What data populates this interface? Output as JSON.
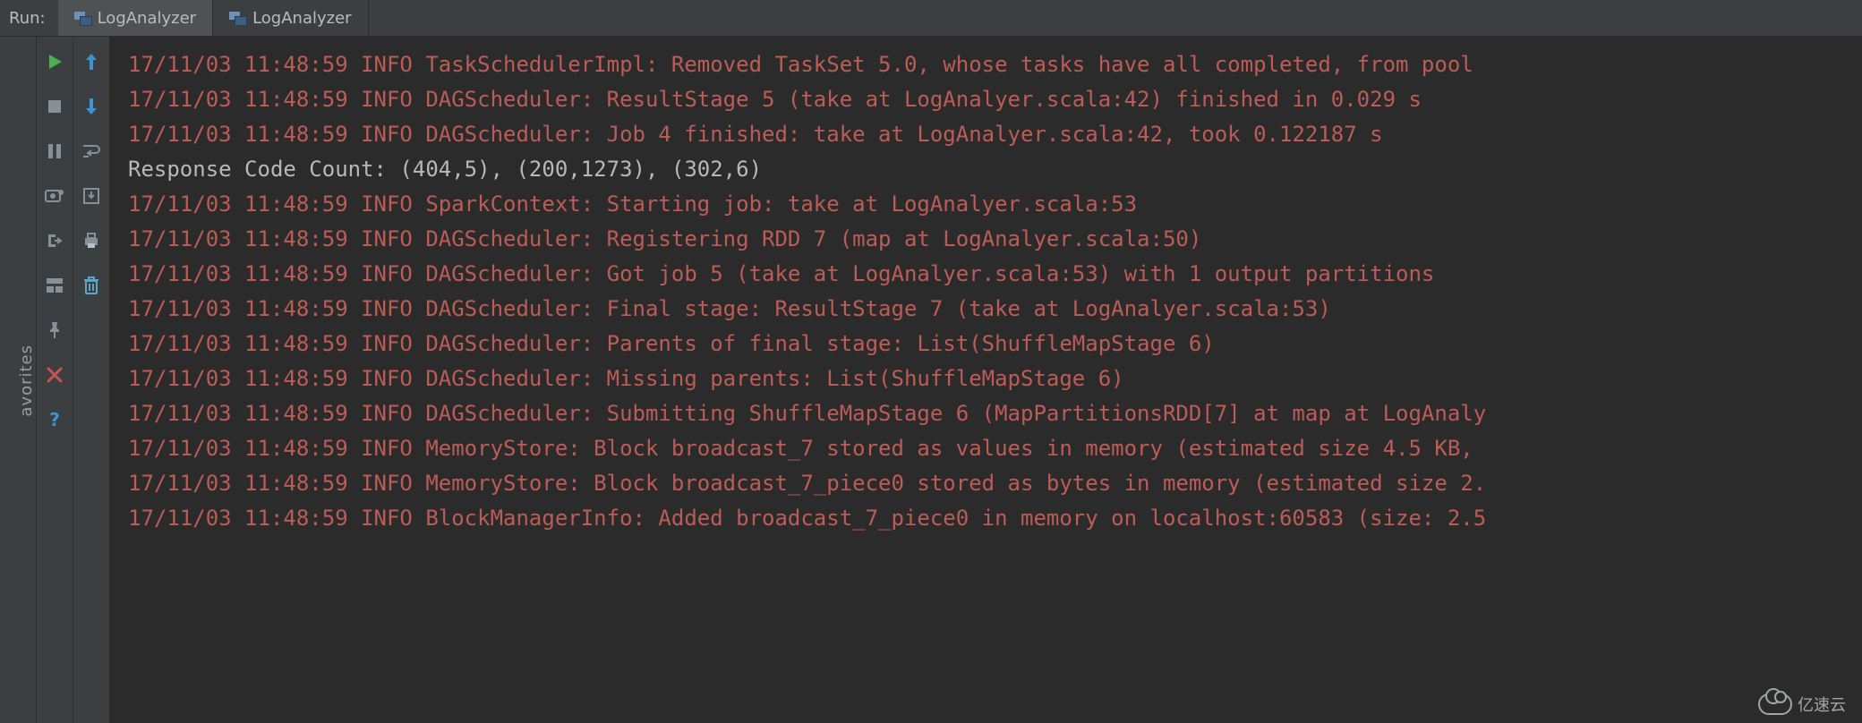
{
  "header": {
    "run_label": "Run:",
    "tabs": [
      {
        "label": "LogAnalyzer",
        "active": true
      },
      {
        "label": "LogAnalyzer",
        "active": false
      }
    ]
  },
  "left_rail": {
    "label": "avorites"
  },
  "toolbar_col1": [
    {
      "name": "rerun-icon",
      "title": "Rerun",
      "color": "#4caf50"
    },
    {
      "name": "stop-icon",
      "title": "Stop",
      "color": "#8a8f94"
    },
    {
      "name": "pause-icon",
      "title": "Pause",
      "color": "#8a8f94"
    },
    {
      "name": "dump-icon",
      "title": "Dump Threads",
      "color": "#8a8f94"
    },
    {
      "name": "exit-icon",
      "title": "Exit",
      "color": "#8a8f94"
    },
    {
      "name": "layout-icon",
      "title": "Restore Layout",
      "color": "#8a8f94"
    },
    {
      "name": "pin-icon",
      "title": "Pin Tab",
      "color": "#8a8f94"
    },
    {
      "name": "close-icon",
      "title": "Close",
      "color": "#c75450"
    },
    {
      "name": "help-icon",
      "title": "Help",
      "color": "#3d94d1"
    }
  ],
  "toolbar_col2": [
    {
      "name": "scroll-up-icon",
      "title": "Up Trace",
      "color": "#3d94d1"
    },
    {
      "name": "scroll-down-icon",
      "title": "Down Trace",
      "color": "#3d94d1"
    },
    {
      "name": "soft-wrap-icon",
      "title": "Soft-Wrap",
      "color": "#8a8f94"
    },
    {
      "name": "scroll-end-icon",
      "title": "Scroll to End",
      "color": "#8a8f94"
    },
    {
      "name": "print-icon",
      "title": "Print",
      "color": "#8a8f94"
    },
    {
      "name": "clear-icon",
      "title": "Clear All",
      "color": "#5aa7c7"
    }
  ],
  "console": {
    "lines": [
      {
        "kind": "log",
        "text": "17/11/03 11:48:59 INFO TaskSchedulerImpl: Removed TaskSet 5.0, whose tasks have all completed, from pool "
      },
      {
        "kind": "log",
        "text": "17/11/03 11:48:59 INFO DAGScheduler: ResultStage 5 (take at LogAnalyer.scala:42) finished in 0.029 s"
      },
      {
        "kind": "log",
        "text": "17/11/03 11:48:59 INFO DAGScheduler: Job 4 finished: take at LogAnalyer.scala:42, took 0.122187 s"
      },
      {
        "kind": "stdout",
        "text": "Response Code Count: (404,5), (200,1273), (302,6)"
      },
      {
        "kind": "log",
        "text": "17/11/03 11:48:59 INFO SparkContext: Starting job: take at LogAnalyer.scala:53"
      },
      {
        "kind": "log",
        "text": "17/11/03 11:48:59 INFO DAGScheduler: Registering RDD 7 (map at LogAnalyer.scala:50)"
      },
      {
        "kind": "log",
        "text": "17/11/03 11:48:59 INFO DAGScheduler: Got job 5 (take at LogAnalyer.scala:53) with 1 output partitions"
      },
      {
        "kind": "log",
        "text": "17/11/03 11:48:59 INFO DAGScheduler: Final stage: ResultStage 7 (take at LogAnalyer.scala:53)"
      },
      {
        "kind": "log",
        "text": "17/11/03 11:48:59 INFO DAGScheduler: Parents of final stage: List(ShuffleMapStage 6)"
      },
      {
        "kind": "log",
        "text": "17/11/03 11:48:59 INFO DAGScheduler: Missing parents: List(ShuffleMapStage 6)"
      },
      {
        "kind": "log",
        "text": "17/11/03 11:48:59 INFO DAGScheduler: Submitting ShuffleMapStage 6 (MapPartitionsRDD[7] at map at LogAnaly"
      },
      {
        "kind": "log",
        "text": "17/11/03 11:48:59 INFO MemoryStore: Block broadcast_7 stored as values in memory (estimated size 4.5 KB, "
      },
      {
        "kind": "log",
        "text": "17/11/03 11:48:59 INFO MemoryStore: Block broadcast_7_piece0 stored as bytes in memory (estimated size 2."
      },
      {
        "kind": "log",
        "text": "17/11/03 11:48:59 INFO BlockManagerInfo: Added broadcast_7_piece0 in memory on localhost:60583 (size: 2.5"
      }
    ]
  },
  "watermark": {
    "text": "亿速云"
  }
}
